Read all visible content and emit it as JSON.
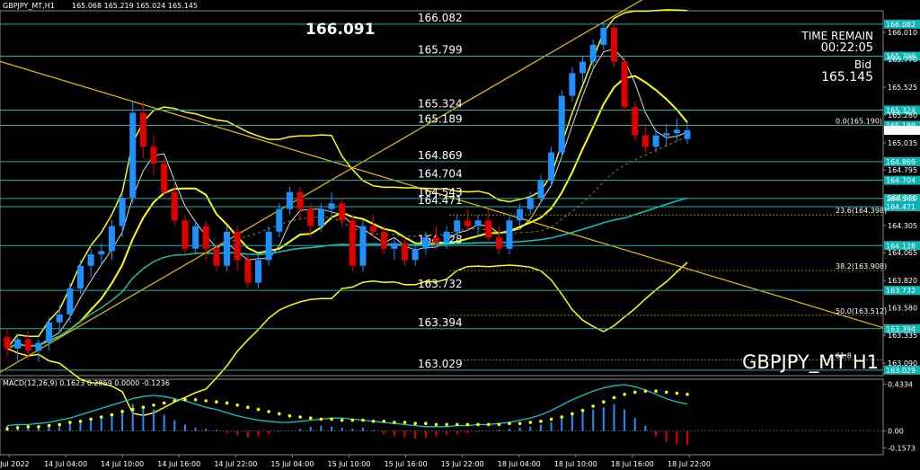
{
  "window": {
    "symbol_header": "GBPJPY_MT,H1",
    "ohlc": "165.068 165.219 165.024 165.145",
    "watermark": "GBPJPY_MT H1",
    "price_label": "166.091"
  },
  "info": {
    "time_remain_label": "TIME REMAIN",
    "time_remain_value": "00:22:05",
    "bid_label": "Bid",
    "bid_value": "165.145"
  },
  "colors": {
    "background": "#000000",
    "bull": "#1e90ff",
    "bear": "#e00000",
    "level_line": "#20b2aa",
    "band": "#ffff00",
    "trendline": "#e6c200",
    "ma": "#00cccc",
    "macd_line": "#00cccc",
    "macd_signal": "#ffff00"
  },
  "chart_data": [
    {
      "type": "candlestick",
      "ylim": [
        162.98,
        166.2
      ],
      "x_ticks": [
        "13 Jul 2022",
        "14 Jul 04:00",
        "14 Jul 10:00",
        "14 Jul 16:00",
        "14 Jul 22:00",
        "15 Jul 04:00",
        "15 Jul 10:00",
        "15 Jul 16:00",
        "15 Jul 22:00",
        "18 Jul 04:00",
        "18 Jul 10:00",
        "18 Jul 16:00",
        "18 Jul 22:00"
      ],
      "y_ticks": [
        "166.010",
        "165.770",
        "165.525",
        "165.280",
        "165.035",
        "164.795",
        "164.550",
        "164.305",
        "164.065",
        "163.820",
        "163.580",
        "163.335",
        "163.090"
      ],
      "levels": [
        {
          "value": 166.082,
          "label": "166.082"
        },
        {
          "value": 165.799,
          "label": "165.799"
        },
        {
          "value": 165.324,
          "label": "165.324"
        },
        {
          "value": 165.189,
          "label": "165.189"
        },
        {
          "value": 164.869,
          "label": "164.869"
        },
        {
          "value": 164.704,
          "label": "164.704"
        },
        {
          "value": 164.543,
          "label": "164.543"
        },
        {
          "value": 164.471,
          "label": "164.471"
        },
        {
          "value": 164.128,
          "label": "164.128"
        },
        {
          "value": 163.732,
          "label": "163.732"
        },
        {
          "value": 163.394,
          "label": "163.394"
        },
        {
          "value": 163.029,
          "label": "163.029"
        }
      ],
      "fib_levels": [
        {
          "value": 165.19,
          "label": "0.0(165.190)"
        },
        {
          "value": 164.398,
          "label": "23.6(164.398)"
        },
        {
          "value": 163.908,
          "label": "38.2(163.908)"
        },
        {
          "value": 163.512,
          "label": "50.0(163.512)"
        },
        {
          "value": 163.12,
          "label": "61.8"
        }
      ],
      "bid_marker": "165.145",
      "candles": [
        [
          163.32,
          163.4,
          163.15,
          163.22
        ],
        [
          163.22,
          163.35,
          163.1,
          163.3
        ],
        [
          163.3,
          163.38,
          163.12,
          163.2
        ],
        [
          163.2,
          163.3,
          163.1,
          163.27
        ],
        [
          163.27,
          163.5,
          163.2,
          163.45
        ],
        [
          163.45,
          163.6,
          163.35,
          163.52
        ],
        [
          163.52,
          163.8,
          163.45,
          163.75
        ],
        [
          163.75,
          164.0,
          163.7,
          163.95
        ],
        [
          163.95,
          164.1,
          163.85,
          164.05
        ],
        [
          164.05,
          164.15,
          163.95,
          164.08
        ],
        [
          164.08,
          164.35,
          164.0,
          164.3
        ],
        [
          164.3,
          164.6,
          164.2,
          164.55
        ],
        [
          164.55,
          165.4,
          164.5,
          165.3
        ],
        [
          165.3,
          165.4,
          164.9,
          165.0
        ],
        [
          165.0,
          165.1,
          164.75,
          164.85
        ],
        [
          164.85,
          164.9,
          164.55,
          164.6
        ],
        [
          164.6,
          164.7,
          164.3,
          164.35
        ],
        [
          164.35,
          164.4,
          164.05,
          164.1
        ],
        [
          164.1,
          164.35,
          164.05,
          164.3
        ],
        [
          164.3,
          164.35,
          164.0,
          164.1
        ],
        [
          164.1,
          164.15,
          163.9,
          163.95
        ],
        [
          163.95,
          164.3,
          163.9,
          164.25
        ],
        [
          164.25,
          164.3,
          163.9,
          164.0
        ],
        [
          164.0,
          164.05,
          163.75,
          163.8
        ],
        [
          163.8,
          164.05,
          163.75,
          164.0
        ],
        [
          164.0,
          164.3,
          163.95,
          164.25
        ],
        [
          164.25,
          164.5,
          164.2,
          164.45
        ],
        [
          164.45,
          164.65,
          164.4,
          164.6
        ],
        [
          164.6,
          164.65,
          164.35,
          164.45
        ],
        [
          164.45,
          164.5,
          164.2,
          164.3
        ],
        [
          164.3,
          164.5,
          164.25,
          164.45
        ],
        [
          164.45,
          164.6,
          164.35,
          164.5
        ],
        [
          164.5,
          164.55,
          164.3,
          164.35
        ],
        [
          164.35,
          164.4,
          163.9,
          163.95
        ],
        [
          163.95,
          164.35,
          163.9,
          164.3
        ],
        [
          164.3,
          164.4,
          164.2,
          164.25
        ],
        [
          164.25,
          164.3,
          164.05,
          164.1
        ],
        [
          164.1,
          164.2,
          164.0,
          164.15
        ],
        [
          164.15,
          164.2,
          163.95,
          164.0
        ],
        [
          164.0,
          164.15,
          163.95,
          164.1
        ],
        [
          164.1,
          164.25,
          164.05,
          164.2
        ],
        [
          164.2,
          164.3,
          164.1,
          164.15
        ],
        [
          164.15,
          164.3,
          164.1,
          164.25
        ],
        [
          164.25,
          164.4,
          164.2,
          164.35
        ],
        [
          164.35,
          164.45,
          164.25,
          164.3
        ],
        [
          164.3,
          164.4,
          164.2,
          164.35
        ],
        [
          164.35,
          164.45,
          164.15,
          164.2
        ],
        [
          164.2,
          164.3,
          164.05,
          164.1
        ],
        [
          164.1,
          164.4,
          164.05,
          164.35
        ],
        [
          164.35,
          164.5,
          164.3,
          164.45
        ],
        [
          164.45,
          164.6,
          164.4,
          164.55
        ],
        [
          164.55,
          164.75,
          164.5,
          164.7
        ],
        [
          164.7,
          165.0,
          164.65,
          164.95
        ],
        [
          164.95,
          165.5,
          164.9,
          165.45
        ],
        [
          165.45,
          165.7,
          165.4,
          165.65
        ],
        [
          165.65,
          165.8,
          165.55,
          165.75
        ],
        [
          165.75,
          165.95,
          165.7,
          165.9
        ],
        [
          165.9,
          166.1,
          165.85,
          166.05
        ],
        [
          166.05,
          166.09,
          165.7,
          165.75
        ],
        [
          165.75,
          165.8,
          165.3,
          165.35
        ],
        [
          165.35,
          165.4,
          165.05,
          165.1
        ],
        [
          165.1,
          165.2,
          164.95,
          165.0
        ],
        [
          165.0,
          165.15,
          164.95,
          165.1
        ],
        [
          165.1,
          165.2,
          165.0,
          165.12
        ],
        [
          165.12,
          165.25,
          165.05,
          165.15
        ],
        [
          165.068,
          165.219,
          165.024,
          165.145
        ]
      ]
    },
    {
      "type": "macd",
      "title": "MACD(12,26,9) 0.1623 0.2859 0.0000 -0.1236",
      "ylim": [
        -0.22,
        0.48
      ],
      "y_ticks": [
        "0.4334",
        "0.00",
        "-0.1573"
      ],
      "histogram": [
        0.05,
        0.06,
        0.05,
        0.04,
        0.05,
        0.06,
        0.07,
        0.08,
        0.1,
        0.12,
        0.15,
        0.2,
        0.25,
        0.22,
        0.2,
        0.15,
        0.1,
        0.06,
        0.03,
        0.02,
        0.01,
        -0.02,
        -0.04,
        -0.06,
        -0.05,
        -0.03,
        -0.01,
        0.0,
        0.02,
        0.04,
        0.05,
        0.04,
        0.03,
        0.02,
        0.03,
        0.01,
        -0.03,
        -0.05,
        -0.06,
        -0.07,
        -0.06,
        -0.05,
        -0.04,
        -0.03,
        -0.02,
        -0.01,
        0.0,
        0.01,
        0.02,
        0.03,
        0.04,
        0.06,
        0.08,
        0.12,
        0.15,
        0.18,
        0.2,
        0.22,
        0.25,
        0.2,
        0.12,
        0.05,
        -0.05,
        -0.1,
        -0.12,
        -0.13
      ],
      "macd": [
        0.05,
        0.06,
        0.06,
        0.07,
        0.08,
        0.1,
        0.12,
        0.15,
        0.18,
        0.21,
        0.24,
        0.27,
        0.3,
        0.32,
        0.33,
        0.32,
        0.3,
        0.28,
        0.25,
        0.22,
        0.2,
        0.17,
        0.14,
        0.12,
        0.1,
        0.09,
        0.08,
        0.08,
        0.09,
        0.1,
        0.11,
        0.12,
        0.12,
        0.11,
        0.1,
        0.09,
        0.08,
        0.07,
        0.06,
        0.05,
        0.04,
        0.04,
        0.04,
        0.05,
        0.05,
        0.06,
        0.06,
        0.07,
        0.08,
        0.1,
        0.12,
        0.15,
        0.19,
        0.24,
        0.29,
        0.33,
        0.37,
        0.4,
        0.42,
        0.43,
        0.41,
        0.38,
        0.34,
        0.3,
        0.27,
        0.25
      ],
      "signal": [
        0.02,
        0.03,
        0.04,
        0.04,
        0.05,
        0.06,
        0.08,
        0.09,
        0.11,
        0.13,
        0.15,
        0.18,
        0.2,
        0.22,
        0.24,
        0.26,
        0.28,
        0.29,
        0.29,
        0.28,
        0.27,
        0.26,
        0.24,
        0.22,
        0.2,
        0.18,
        0.16,
        0.14,
        0.13,
        0.12,
        0.11,
        0.11,
        0.1,
        0.1,
        0.1,
        0.09,
        0.09,
        0.08,
        0.08,
        0.07,
        0.07,
        0.06,
        0.06,
        0.06,
        0.06,
        0.06,
        0.06,
        0.06,
        0.07,
        0.07,
        0.08,
        0.09,
        0.11,
        0.13,
        0.16,
        0.19,
        0.23,
        0.27,
        0.31,
        0.34,
        0.36,
        0.37,
        0.37,
        0.36,
        0.35,
        0.34
      ]
    }
  ]
}
